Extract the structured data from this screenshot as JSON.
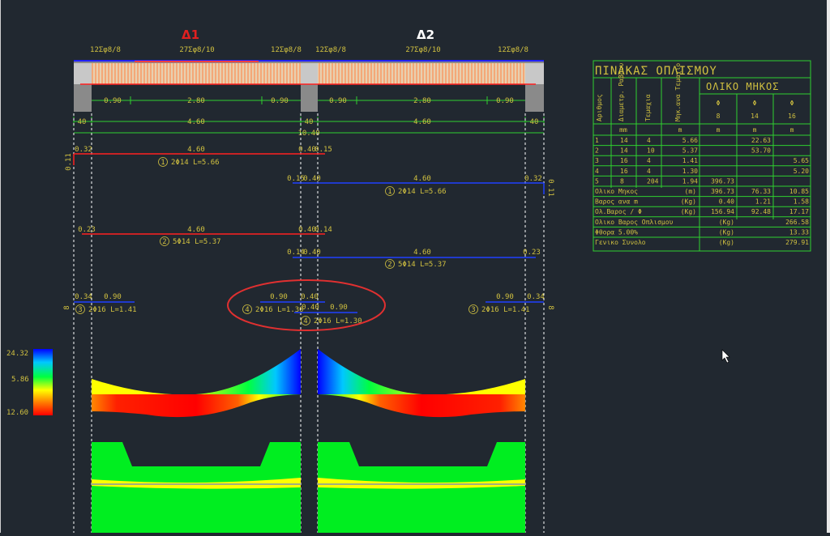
{
  "spans": {
    "d1_title": "Δ1",
    "d2_title": "Δ2",
    "d1_color": "#e02020",
    "d2_color": "#ffffff"
  },
  "stirrups": {
    "s1": "12Σφ8/8",
    "s2": "27Σφ8/10",
    "s3": "12Σφ8/8",
    "s4": "12Σφ8/8",
    "s5": "27Σφ8/10",
    "s6": "12Σφ8/8"
  },
  "dims": {
    "row1": [
      "0.90",
      "2.80",
      "0.90",
      "0.90",
      "2.80",
      "0.90"
    ],
    "row2": [
      "40",
      "4.60",
      "40",
      "4.60",
      "40"
    ],
    "total": "10.40"
  },
  "bars": {
    "b1_left": "0.32",
    "b1_mid": "4.60",
    "b1_right": "0.40",
    "b1_right2": "0.15",
    "b1_vert": "0.11",
    "b1_num": "1",
    "b1_label": "2Φ14 L=5.66",
    "b2_left": "0.15",
    "b2_left2": "0.40",
    "b2_mid": "4.60",
    "b2_right": "0.32",
    "b2_vert": "0.11",
    "b2_num": "1",
    "b2_label": "2Φ14 L=5.66",
    "b3_left": "0.23",
    "b3_mid": "4.60",
    "b3_right": "0.40",
    "b3_right2": "0.14",
    "b3_num": "2",
    "b3_label": "5Φ14 L=5.37",
    "b4_left": "0.14",
    "b4_left2": "0.40",
    "b4_mid": "4.60",
    "b4_right": "0.23",
    "b4_num": "2",
    "b4_label": "5Φ14 L=5.37",
    "b5_left": "0.34",
    "b5_mid": "0.90",
    "b5_vert": "8",
    "b5_num": "3",
    "b5_label": "2Φ16 L=1.41",
    "b6_mid": "0.90",
    "b6_right": "0.40",
    "b6_num": "4",
    "b6_label": "2Φ16 L=1.30",
    "b7_left": "0.40",
    "b7_mid": "0.90",
    "b7_num": "4",
    "b7_label": "2Φ16 L=1.30",
    "b8_mid": "0.90",
    "b8_right": "0.34",
    "b8_vert": "8",
    "b8_num": "3",
    "b8_label": "2Φ16 L=1.41"
  },
  "legend": {
    "max": "24.32",
    "mid": "5.86",
    "min": "12.60"
  },
  "table": {
    "title": "ΠΙΝΑΚΑΣ ΟΠΛΙΣΜΟΥ",
    "subtitle": "ΟΛΙΚΟ ΜΗΚΟΣ",
    "col_headers": [
      "Αριθμος",
      "Διαμετρ. Ραβδου",
      "Τεμαχια",
      "Μηκ.ανα Τεμαχιο"
    ],
    "phi": [
      "Φ",
      "Φ",
      "Φ"
    ],
    "diam": [
      "8",
      "14",
      "16"
    ],
    "units": [
      "mm",
      "m",
      "m",
      "m",
      "m"
    ],
    "rows": [
      [
        "1",
        "14",
        "4",
        "5.66",
        "",
        "22.63",
        ""
      ],
      [
        "2",
        "14",
        "10",
        "5.37",
        "",
        "53.70",
        ""
      ],
      [
        "3",
        "16",
        "4",
        "1.41",
        "",
        "",
        "5.65"
      ],
      [
        "4",
        "16",
        "4",
        "1.30",
        "",
        "",
        "5.20"
      ],
      [
        "5",
        "8",
        "204",
        "1.94",
        "396.73",
        "",
        ""
      ]
    ],
    "summary": [
      {
        "label": "Ολικο Μηκος",
        "unit": "(m)",
        "v8": "396.73",
        "v14": "76.33",
        "v16": "10.85"
      },
      {
        "label": "Βαρος ανα m",
        "unit": "(Kg)",
        "v8": "0.40",
        "v14": "1.21",
        "v16": "1.58"
      },
      {
        "label": "Ολ.Βαρος / Φ",
        "unit": "(Kg)",
        "v8": "156.94",
        "v14": "92.48",
        "v16": "17.17"
      }
    ],
    "totals": [
      {
        "label": "Ολικο Βαρος Οπλισμου",
        "unit": "(Kg)",
        "value": "266.58"
      },
      {
        "label": "Φθορα 5.00%",
        "unit": "(Kg)",
        "value": "13.33"
      },
      {
        "label": "Γενικο Συνολο",
        "unit": "(Kg)",
        "value": "279.91"
      }
    ]
  }
}
